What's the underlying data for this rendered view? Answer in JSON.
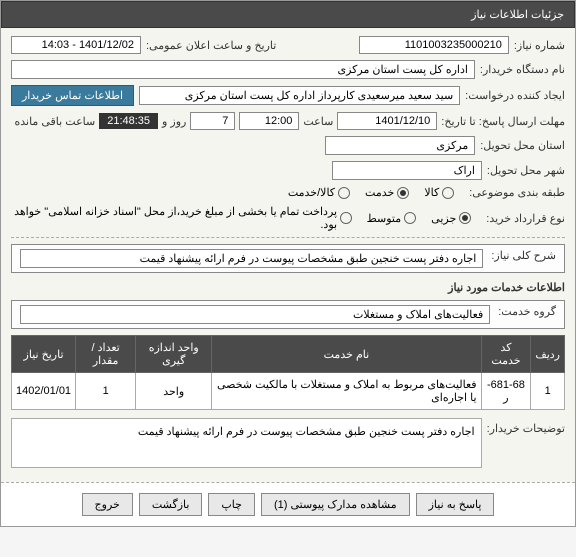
{
  "header": {
    "title": "جزئیات اطلاعات نیاز"
  },
  "fields": {
    "req_no_label": "شماره نیاز:",
    "req_no": "1101003235000210",
    "ann_date_label": "تاریخ و ساعت اعلان عمومی:",
    "ann_date": "1401/12/02 - 14:03",
    "buyer_label": "نام دستگاه خریدار:",
    "buyer": "اداره کل پست استان مرکزی",
    "creator_label": "ایجاد کننده درخواست:",
    "creator": "سید سعید میرسعیدی کارپرداز اداره کل پست استان مرکزی",
    "contact_btn": "اطلاعات تماس خریدار",
    "deadline_label": "مهلت ارسال پاسخ: تا تاریخ:",
    "deadline_date": "1401/12/10",
    "time_lbl": "ساعت",
    "deadline_time": "12:00",
    "days": "7",
    "days_lbl": "روز و",
    "remain_time": "21:48:35",
    "remain_lbl": "ساعت باقی مانده",
    "prov_label": "استان محل تحویل:",
    "prov": "مرکزی",
    "city_label": "شهر محل تحویل:",
    "city": "اراک",
    "type_label": "طبقه بندی موضوعی:",
    "type_a": "کالا",
    "type_b": "خدمت",
    "type_c": "کالا/خدمت",
    "agree_label": "نوع قرارداد خرید:",
    "agree_a": "جزیی",
    "agree_b": "متوسط",
    "agree_note": "پرداخت تمام یا بخشی از مبلغ خرید،از محل \"اسناد خزانه اسلامی\" خواهد بود.",
    "desc_label": "شرح کلی نیاز:",
    "desc_val": "اجاره  دفتر پست خنجین   طبق مشخصات پیوست در فرم ارائه پیشنهاد قیمت",
    "svc_label": "اطلاعات خدمات مورد نیاز",
    "grp_label": "گروه خدمت:",
    "grp_val": "فعالیت‌های  املاک و مستغلات",
    "buyer_notes_label": "توضیحات خریدار:",
    "buyer_notes": "اجاره  دفتر پست خنجین   طبق مشخصات پیوست در فرم ارائه پیشنهاد قیمت"
  },
  "table": {
    "headers": {
      "row": "ردیف",
      "code": "کد خدمت",
      "name": "نام خدمت",
      "unit": "واحد اندازه گیری",
      "qty": "تعداد / مقدار",
      "date": "تاریخ نیاز"
    },
    "rows": [
      {
        "row": "1",
        "code": "681-68-ر",
        "name": "فعالیت‌های مربوط به املاک و مستغلات با مالکیت شخصی یا اجاره‌ای",
        "unit": "واحد",
        "qty": "1",
        "date": "1402/01/01"
      }
    ]
  },
  "actions": {
    "reply": "پاسخ به نیاز",
    "attach": "مشاهده مدارک پیوستی (1)",
    "print": "چاپ",
    "back": "بازگشت",
    "exit": "خروج"
  }
}
